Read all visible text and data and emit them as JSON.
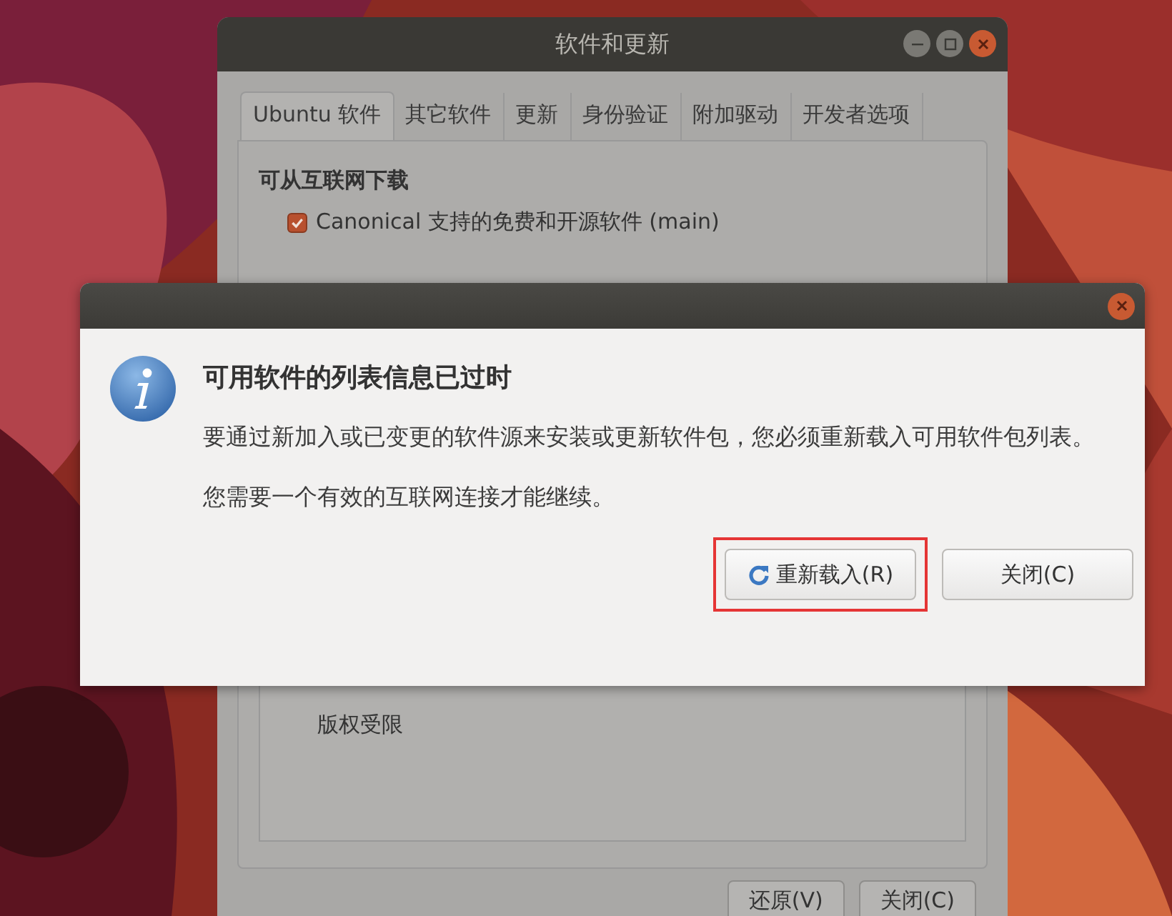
{
  "main_window": {
    "title": "软件和更新",
    "tabs": [
      {
        "label": "Ubuntu 软件",
        "selected": true
      },
      {
        "label": "其它软件",
        "selected": false
      },
      {
        "label": "更新",
        "selected": false
      },
      {
        "label": "身份验证",
        "selected": false
      },
      {
        "label": "附加驱动",
        "selected": false
      },
      {
        "label": "开发者选项",
        "selected": false
      }
    ],
    "section_heading": "可从互联网下载",
    "sources": [
      {
        "label": "Canonical 支持的免费和开源软件 (main)",
        "checked": true
      }
    ],
    "list_box_lines": [
      "版权受限"
    ],
    "buttons": [
      "还原(V)",
      "关闭(C)"
    ]
  },
  "dialog": {
    "heading": "可用软件的列表信息已过时",
    "paragraphs": [
      "要通过新加入或已变更的软件源来安装或更新软件包，您必须重新载入可用软件包列表。",
      "您需要一个有效的互联网连接才能继续。"
    ],
    "buttons": [
      {
        "label": "重新载入(R)",
        "kind": "reload",
        "highlighted": true
      },
      {
        "label": "关闭(C)",
        "kind": "plain",
        "highlighted": false
      }
    ]
  }
}
